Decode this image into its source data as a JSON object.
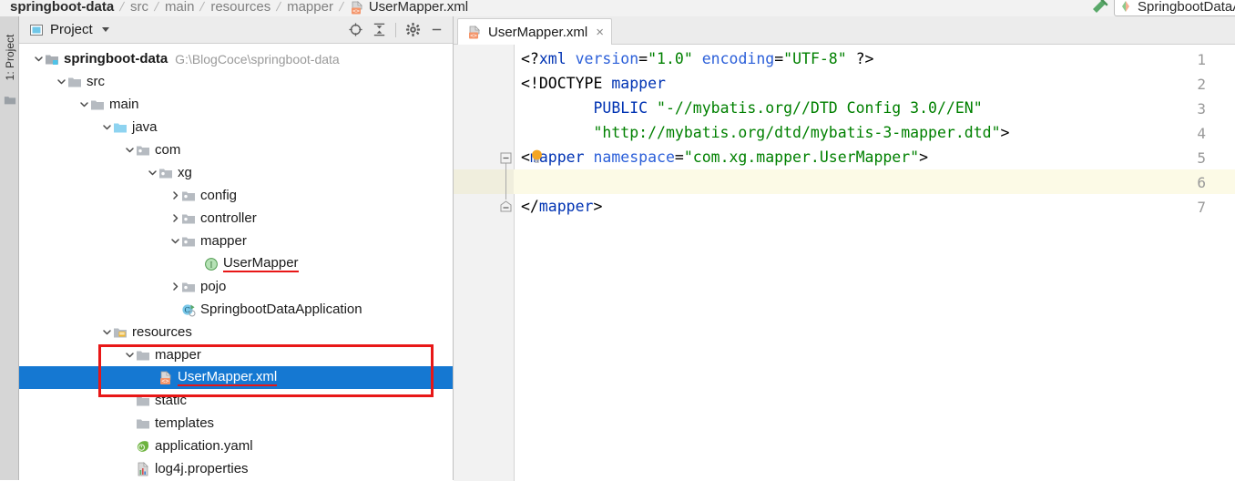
{
  "navbar": {
    "breadcrumbs": [
      {
        "label": "springboot-data",
        "style": "root",
        "icon": ""
      },
      {
        "label": "src",
        "style": "dim",
        "icon": ""
      },
      {
        "label": "main",
        "style": "dim",
        "icon": ""
      },
      {
        "label": "resources",
        "style": "dim",
        "icon": ""
      },
      {
        "label": "mapper",
        "style": "dim",
        "icon": ""
      },
      {
        "label": "UserMapper.xml",
        "style": "file",
        "icon": "xml-file-icon"
      }
    ],
    "build_icon": "build-hammer-icon",
    "run_config": "SpringbootDataA",
    "run_config_icon": "spring-boot-icon"
  },
  "toolwindow_strip": {
    "label": "1: Project",
    "icon": "project-folder-icon"
  },
  "project_panel": {
    "title": "Project",
    "title_icon": "project-view-icon",
    "caret_icon": "chevron-down-icon",
    "tools": [
      {
        "name": "locate-in-tree-icon",
        "label": "Select Opened File"
      },
      {
        "name": "collapse-all-icon",
        "label": "Collapse All"
      },
      {
        "name": "gear-icon",
        "label": "Settings"
      },
      {
        "name": "minimize-icon",
        "label": "Hide"
      }
    ],
    "tree": [
      {
        "indent": 0,
        "arrow": "down",
        "icon": "module-icon",
        "label": "springboot-data",
        "bold": true,
        "path": "G:\\BlogCoce\\springboot-data",
        "selected": false,
        "underline": false
      },
      {
        "indent": 1,
        "arrow": "down",
        "icon": "folder-icon",
        "label": "src",
        "bold": false,
        "path": "",
        "selected": false,
        "underline": false
      },
      {
        "indent": 2,
        "arrow": "down",
        "icon": "folder-icon",
        "label": "main",
        "bold": false,
        "path": "",
        "selected": false,
        "underline": false
      },
      {
        "indent": 3,
        "arrow": "down",
        "icon": "source-root-icon",
        "label": "java",
        "bold": false,
        "path": "",
        "selected": false,
        "underline": false
      },
      {
        "indent": 4,
        "arrow": "down",
        "icon": "package-icon",
        "label": "com",
        "bold": false,
        "path": "",
        "selected": false,
        "underline": false
      },
      {
        "indent": 5,
        "arrow": "down",
        "icon": "package-icon",
        "label": "xg",
        "bold": false,
        "path": "",
        "selected": false,
        "underline": false
      },
      {
        "indent": 6,
        "arrow": "right",
        "icon": "package-icon",
        "label": "config",
        "bold": false,
        "path": "",
        "selected": false,
        "underline": false
      },
      {
        "indent": 6,
        "arrow": "right",
        "icon": "package-icon",
        "label": "controller",
        "bold": false,
        "path": "",
        "selected": false,
        "underline": false
      },
      {
        "indent": 6,
        "arrow": "down",
        "icon": "package-icon",
        "label": "mapper",
        "bold": false,
        "path": "",
        "selected": false,
        "underline": false
      },
      {
        "indent": 7,
        "arrow": "none",
        "icon": "interface-icon",
        "label": "UserMapper",
        "bold": false,
        "path": "",
        "selected": false,
        "underline": true
      },
      {
        "indent": 6,
        "arrow": "right",
        "icon": "package-icon",
        "label": "pojo",
        "bold": false,
        "path": "",
        "selected": false,
        "underline": false
      },
      {
        "indent": 6,
        "arrow": "none",
        "icon": "spring-class-icon",
        "label": "SpringbootDataApplication",
        "bold": false,
        "path": "",
        "selected": false,
        "underline": false
      },
      {
        "indent": 3,
        "arrow": "down",
        "icon": "resource-root-icon",
        "label": "resources",
        "bold": false,
        "path": "",
        "selected": false,
        "underline": false
      },
      {
        "indent": 4,
        "arrow": "down",
        "icon": "folder-icon",
        "label": "mapper",
        "bold": false,
        "path": "",
        "selected": false,
        "underline": false
      },
      {
        "indent": 5,
        "arrow": "none",
        "icon": "xml-file-icon",
        "label": "UserMapper.xml",
        "bold": false,
        "path": "",
        "selected": true,
        "underline": true
      },
      {
        "indent": 4,
        "arrow": "none",
        "icon": "folder-icon",
        "label": "static",
        "bold": false,
        "path": "",
        "selected": false,
        "underline": false
      },
      {
        "indent": 4,
        "arrow": "none",
        "icon": "folder-icon",
        "label": "templates",
        "bold": false,
        "path": "",
        "selected": false,
        "underline": false
      },
      {
        "indent": 4,
        "arrow": "none",
        "icon": "yaml-spring-icon",
        "label": "application.yaml",
        "bold": false,
        "path": "",
        "selected": false,
        "underline": false
      },
      {
        "indent": 4,
        "arrow": "none",
        "icon": "properties-icon",
        "label": "log4j.properties",
        "bold": false,
        "path": "",
        "selected": false,
        "underline": false
      }
    ]
  },
  "editor": {
    "tabs": [
      {
        "label": "UserMapper.xml",
        "icon": "xml-file-icon",
        "close": "×",
        "active": true
      }
    ],
    "current_line": 6,
    "lines": [
      {
        "no": "1",
        "tokens": [
          {
            "t": "<?",
            "c": "punct"
          },
          {
            "t": "xml",
            "c": "name"
          },
          {
            "t": " ",
            "c": "plain"
          },
          {
            "t": "version",
            "c": "attr"
          },
          {
            "t": "=",
            "c": "punct"
          },
          {
            "t": "\"1.0\"",
            "c": "val"
          },
          {
            "t": " ",
            "c": "plain"
          },
          {
            "t": "encoding",
            "c": "attr"
          },
          {
            "t": "=",
            "c": "punct"
          },
          {
            "t": "\"UTF-8\"",
            "c": "val"
          },
          {
            "t": " ",
            "c": "plain"
          },
          {
            "t": "?>",
            "c": "punct"
          }
        ]
      },
      {
        "no": "2",
        "tokens": [
          {
            "t": "<!DOCTYPE",
            "c": "punct"
          },
          {
            "t": " ",
            "c": "plain"
          },
          {
            "t": "mapper",
            "c": "name"
          }
        ]
      },
      {
        "no": "3",
        "tokens": [
          {
            "t": "        ",
            "c": "plain"
          },
          {
            "t": "PUBLIC",
            "c": "name"
          },
          {
            "t": " ",
            "c": "plain"
          },
          {
            "t": "\"-//mybatis.org//DTD Config 3.0//EN\"",
            "c": "val"
          }
        ]
      },
      {
        "no": "4",
        "tokens": [
          {
            "t": "        ",
            "c": "plain"
          },
          {
            "t": "\"http://mybatis.org/dtd/mybatis-3-mapper.dtd\"",
            "c": "val"
          },
          {
            "t": ">",
            "c": "punct"
          }
        ]
      },
      {
        "no": "5",
        "tokens": [
          {
            "t": "<",
            "c": "punct"
          },
          {
            "t": "mapper",
            "c": "name"
          },
          {
            "t": " ",
            "c": "plain"
          },
          {
            "t": "namespace",
            "c": "attr"
          },
          {
            "t": "=",
            "c": "punct"
          },
          {
            "t": "\"com.xg.mapper.UserMapper\"",
            "c": "val"
          },
          {
            "t": ">",
            "c": "punct"
          }
        ]
      },
      {
        "no": "6",
        "tokens": []
      },
      {
        "no": "7",
        "tokens": [
          {
            "t": "</",
            "c": "punct"
          },
          {
            "t": "mapper",
            "c": "name"
          },
          {
            "t": ">",
            "c": "punct"
          }
        ]
      }
    ],
    "intention_bulb": {
      "name": "intention-bulb-icon",
      "line": 5
    },
    "fold_markers": [
      {
        "line": 5,
        "type": "expanded-top"
      },
      {
        "line": 7,
        "type": "expanded-bottom"
      }
    ]
  },
  "annotations": {
    "red_box": {
      "label": "highlight-rectangle",
      "color": "#e81717"
    },
    "red_underline_color": "#e81717"
  },
  "colors": {
    "selection_blue": "#1578d2",
    "current_line_yellow": "#fcfae6",
    "xml_tag_blue": "#0033b3",
    "xml_value_green": "#008000",
    "panel_gray": "#ececec"
  }
}
